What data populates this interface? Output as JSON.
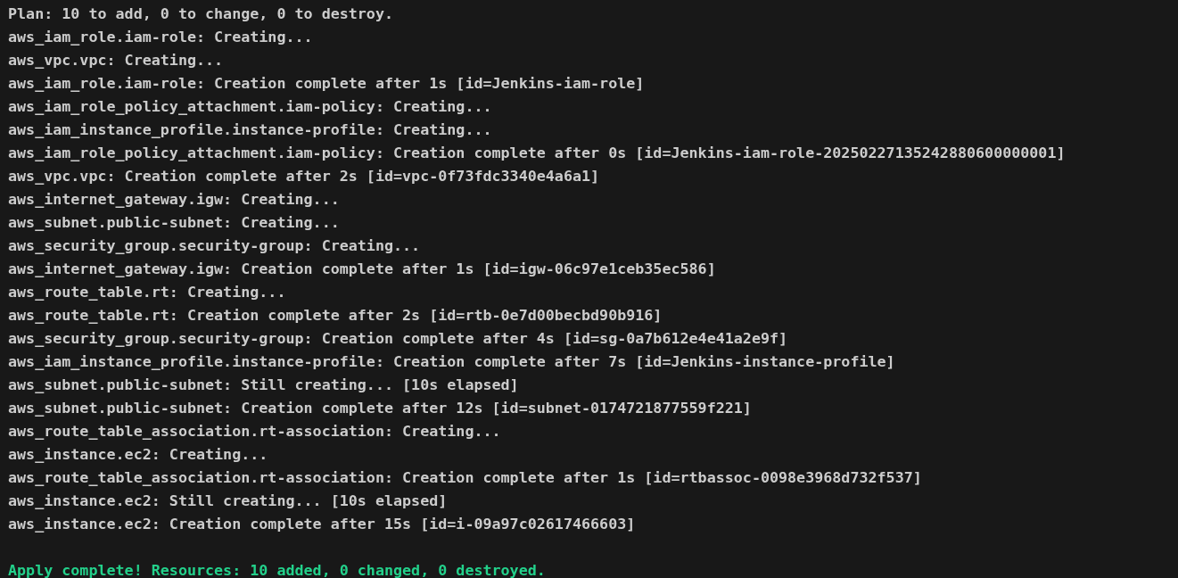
{
  "terminal": {
    "lines": [
      {
        "kind": "output",
        "text": "Plan: 10 to add, 0 to change, 0 to destroy."
      },
      {
        "kind": "output",
        "text": "aws_iam_role.iam-role: Creating..."
      },
      {
        "kind": "output",
        "text": "aws_vpc.vpc: Creating..."
      },
      {
        "kind": "output",
        "text": "aws_iam_role.iam-role: Creation complete after 1s [id=Jenkins-iam-role]"
      },
      {
        "kind": "output",
        "text": "aws_iam_role_policy_attachment.iam-policy: Creating..."
      },
      {
        "kind": "output",
        "text": "aws_iam_instance_profile.instance-profile: Creating..."
      },
      {
        "kind": "output",
        "text": "aws_iam_role_policy_attachment.iam-policy: Creation complete after 0s [id=Jenkins-iam-role-20250227135242880600000001]"
      },
      {
        "kind": "output",
        "text": "aws_vpc.vpc: Creation complete after 2s [id=vpc-0f73fdc3340e4a6a1]"
      },
      {
        "kind": "output",
        "text": "aws_internet_gateway.igw: Creating..."
      },
      {
        "kind": "output",
        "text": "aws_subnet.public-subnet: Creating..."
      },
      {
        "kind": "output",
        "text": "aws_security_group.security-group: Creating..."
      },
      {
        "kind": "output",
        "text": "aws_internet_gateway.igw: Creation complete after 1s [id=igw-06c97e1ceb35ec586]"
      },
      {
        "kind": "output",
        "text": "aws_route_table.rt: Creating..."
      },
      {
        "kind": "output",
        "text": "aws_route_table.rt: Creation complete after 2s [id=rtb-0e7d00becbd90b916]"
      },
      {
        "kind": "output",
        "text": "aws_security_group.security-group: Creation complete after 4s [id=sg-0a7b612e4e41a2e9f]"
      },
      {
        "kind": "output",
        "text": "aws_iam_instance_profile.instance-profile: Creation complete after 7s [id=Jenkins-instance-profile]"
      },
      {
        "kind": "output",
        "text": "aws_subnet.public-subnet: Still creating... [10s elapsed]"
      },
      {
        "kind": "output",
        "text": "aws_subnet.public-subnet: Creation complete after 12s [id=subnet-0174721877559f221]"
      },
      {
        "kind": "output",
        "text": "aws_route_table_association.rt-association: Creating..."
      },
      {
        "kind": "output",
        "text": "aws_instance.ec2: Creating..."
      },
      {
        "kind": "output",
        "text": "aws_route_table_association.rt-association: Creation complete after 1s [id=rtbassoc-0098e3968d732f537]"
      },
      {
        "kind": "output",
        "text": "aws_instance.ec2: Still creating... [10s elapsed]"
      },
      {
        "kind": "output",
        "text": "aws_instance.ec2: Creation complete after 15s [id=i-09a97c02617466603]"
      },
      {
        "kind": "blank"
      },
      {
        "kind": "success",
        "text": "Apply complete! Resources: 10 added, 0 changed, 0 destroyed."
      }
    ]
  }
}
